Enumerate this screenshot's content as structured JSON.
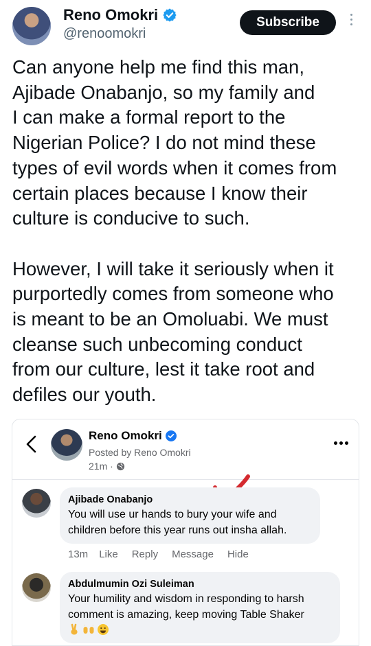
{
  "tweet": {
    "author_name": "Reno Omokri",
    "handle": "@renoomokri",
    "subscribe_label": "Subscribe",
    "text": "Can anyone help me find this man,\nAjibade Onabanjo, so my family and\nI can make a formal report to the\nNigerian Police? I do not mind these\ntypes of evil words when it comes from\ncertain places because I know their\nculture is conducive to such.\n\nHowever, I will take it seriously when it\npurportedly comes from someone who\nis meant to be an Omoluabi. We must\ncleanse such unbecoming conduct\nfrom our culture, lest it take root and\ndefiles our youth."
  },
  "embedded_post": {
    "author_name": "Reno Omokri",
    "posted_by": "Posted by Reno Omokri",
    "time": "21m ·",
    "comments": [
      {
        "name": "Ajibade Onabanjo",
        "text": "You will use ur hands to bury your wife and\nchildren before this year runs out insha allah.",
        "time": "13m",
        "actions": [
          "Like",
          "Reply",
          "Message",
          "Hide"
        ]
      },
      {
        "name": "Abdulmumin Ozi Suleiman",
        "text": "Your humility and wisdom in responding to harsh\ncomment is amazing, keep moving Table Shaker",
        "emojis": [
          "victory-hand-icon",
          "raising-hands-icon",
          "grinning-face-icon"
        ]
      }
    ]
  },
  "colors": {
    "verified_blue": "#1d9bf0",
    "fb_blue": "#1877f2",
    "arrow_red": "#d42a2f"
  }
}
